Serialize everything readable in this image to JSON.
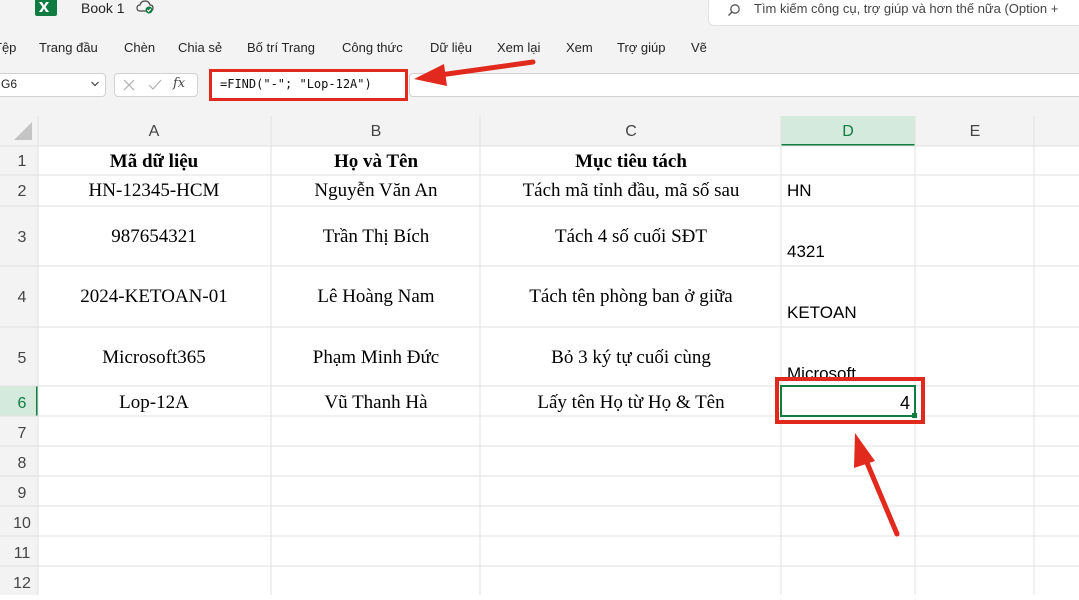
{
  "titlebar": {
    "app_icon": "excel-icon",
    "book_title": "Book 1",
    "sync_icon": "cloud-check-icon",
    "search_placeholder": "Tìm kiếm công cụ, trợ giúp và hơn thế nữa (Option +"
  },
  "ribbon": {
    "tabs": [
      "Tệp",
      "Trang đầu",
      "Chèn",
      "Chia sẻ",
      "Bố trí Trang",
      "Công thức",
      "Dữ liệu",
      "Xem lại",
      "Xem",
      "Trợ giúp",
      "Vẽ"
    ]
  },
  "formula_bar": {
    "name_box": "G6",
    "formula": "=FIND(\"-\"; \"Lop-12A\")"
  },
  "sheet": {
    "columns": [
      "A",
      "B",
      "C",
      "D",
      "E"
    ],
    "selected_column": "D",
    "selected_row": "6",
    "row_numbers": [
      "1",
      "2",
      "3",
      "4",
      "5",
      "6",
      "7",
      "8",
      "9",
      "10",
      "11",
      "12"
    ],
    "header_row": {
      "a": "Mã dữ liệu",
      "b": "Họ và Tên",
      "c": "Mục tiêu tách",
      "d": ""
    },
    "rows": [
      {
        "a": "HN-12345-HCM",
        "b": "Nguyễn Văn An",
        "c": "Tách mã tỉnh đầu, mã số sau",
        "d": "HN"
      },
      {
        "a": "987654321",
        "b": "Trần Thị Bích",
        "c": "Tách 4 số cuối SĐT",
        "d": "4321"
      },
      {
        "a": "2024-KETOAN-01",
        "b": "Lê Hoàng Nam",
        "c": "Tách tên phòng ban ở giữa",
        "d": "KETOAN"
      },
      {
        "a": "Microsoft365",
        "b": "Phạm Minh Đức",
        "c": "Bỏ 3 ký tự cuối cùng",
        "d": "Microsoft"
      },
      {
        "a": "Lop-12A",
        "b": "Vũ Thanh Hà",
        "c": "Lấy tên Họ từ Họ & Tên",
        "d": "4"
      }
    ]
  },
  "colors": {
    "annotation_red": "#e1291d",
    "selection_green": "#107c41"
  }
}
